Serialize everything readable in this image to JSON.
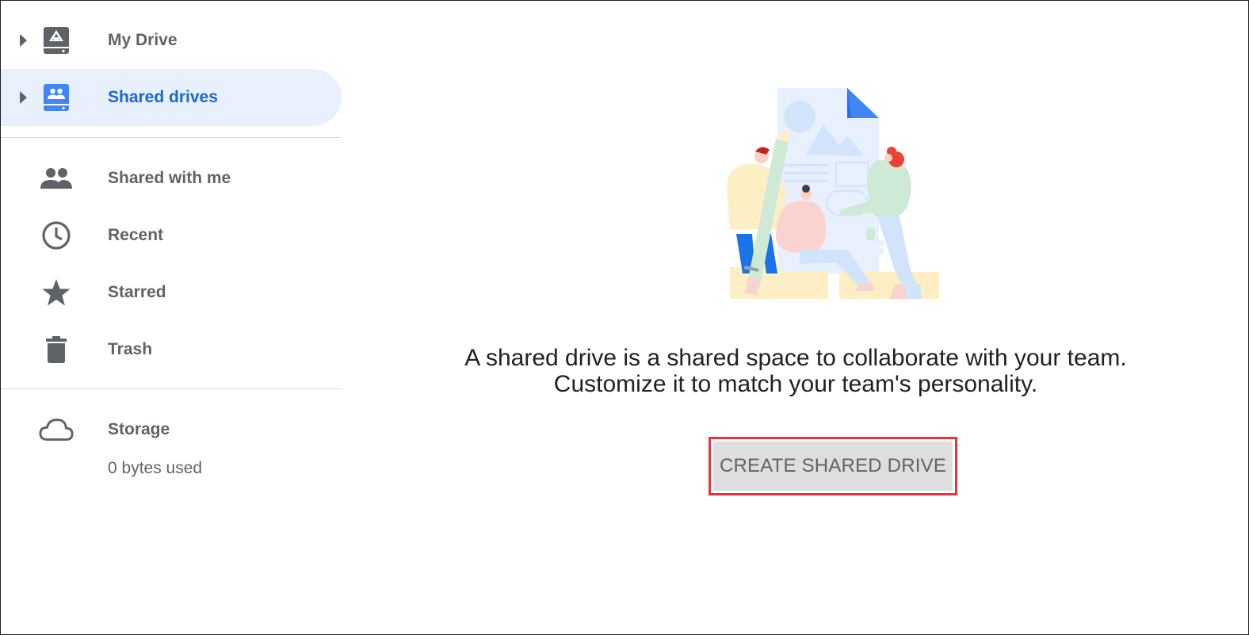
{
  "sidebar": {
    "items": [
      {
        "label": "My Drive",
        "icon": "drive-icon",
        "expandable": true,
        "active": false
      },
      {
        "label": "Shared drives",
        "icon": "shared-drives-icon",
        "expandable": true,
        "active": true
      },
      {
        "label": "Shared with me",
        "icon": "people-icon",
        "expandable": false,
        "active": false
      },
      {
        "label": "Recent",
        "icon": "clock-icon",
        "expandable": false,
        "active": false
      },
      {
        "label": "Starred",
        "icon": "star-icon",
        "expandable": false,
        "active": false
      },
      {
        "label": "Trash",
        "icon": "trash-icon",
        "expandable": false,
        "active": false
      }
    ],
    "storage": {
      "label": "Storage",
      "icon": "cloud-icon",
      "usage": "0 bytes used"
    }
  },
  "main": {
    "message_line1": "A shared drive is a shared space to collaborate with your team.",
    "message_line2": "Customize it to match your team's personality.",
    "create_button_label": "CREATE SHARED DRIVE"
  },
  "colors": {
    "accent": "#1967d2",
    "active_bg": "#e8f0fe",
    "highlight_border": "#e8353d",
    "icon_gray": "#5f6368"
  }
}
